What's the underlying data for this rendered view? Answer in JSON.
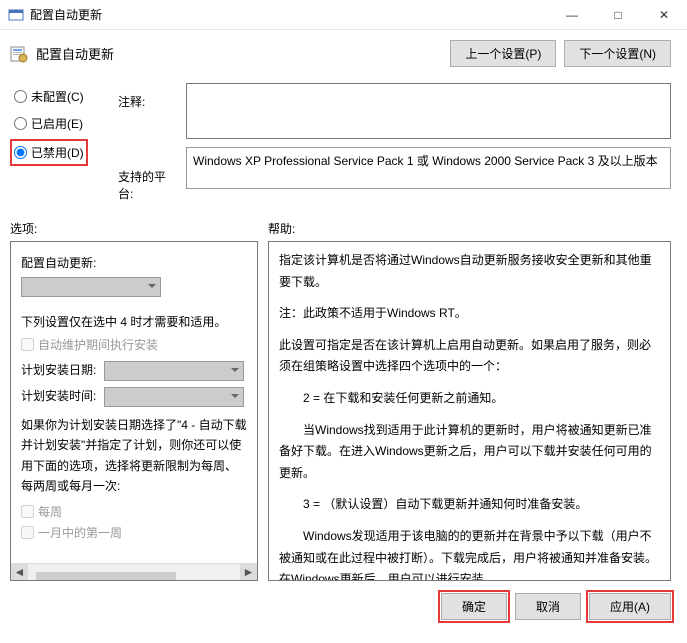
{
  "window": {
    "title": "配置自动更新",
    "minimize": "—",
    "maximize": "□",
    "close": "✕"
  },
  "header": {
    "title": "配置自动更新",
    "prev_btn": "上一个设置(P)",
    "next_btn": "下一个设置(N)"
  },
  "radios": {
    "not_configured": "未配置(C)",
    "enabled": "已启用(E)",
    "disabled": "已禁用(D)"
  },
  "labels": {
    "comment": "注释:",
    "platform": "支持的平台:",
    "options": "选项:",
    "help": "帮助:"
  },
  "platform_text": "Windows XP Professional Service Pack 1 或 Windows 2000 Service Pack 3 及以上版本",
  "options_pane": {
    "section1": "配置自动更新:",
    "note1": "下列设置仅在选中 4 时才需要和适用。",
    "chk1": "自动维护期间执行安装",
    "sched_day": "计划安装日期:",
    "sched_time": "计划安装时间:",
    "note2": "如果你为计划安装日期选择了\"4 - 自动下载并计划安装\"并指定了计划，则你还可以使用下面的选项，选择将更新限制为每周、每两周或每月一次:",
    "chk2": "每周",
    "chk3": "一月中的第一周"
  },
  "help": {
    "p1": "指定该计算机是否将通过Windows自动更新服务接收安全更新和其他重要下载。",
    "p2": "注：此政策不适用于Windows RT。",
    "p3": "此设置可指定是否在该计算机上启用自动更新。如果启用了服务，则必须在组策略设置中选择四个选项中的一个：",
    "p4": "2 = 在下载和安装任何更新之前通知。",
    "p5": "当Windows找到适用于此计算机的更新时，用户将被通知更新已准备好下载。在进入Windows更新之后，用户可以下载并安装任何可用的更新。",
    "p6": "3 = （默认设置）自动下载更新并通知何时准备安装。",
    "p7": "Windows发现适用于该电脑的的更新并在背景中予以下载（用户不被通知或在此过程中被打断）。下载完成后，用户将被通知并准备安装。在Windows更新后，用户可以进行安装。"
  },
  "footer": {
    "ok": "确定",
    "cancel": "取消",
    "apply": "应用(A)"
  }
}
